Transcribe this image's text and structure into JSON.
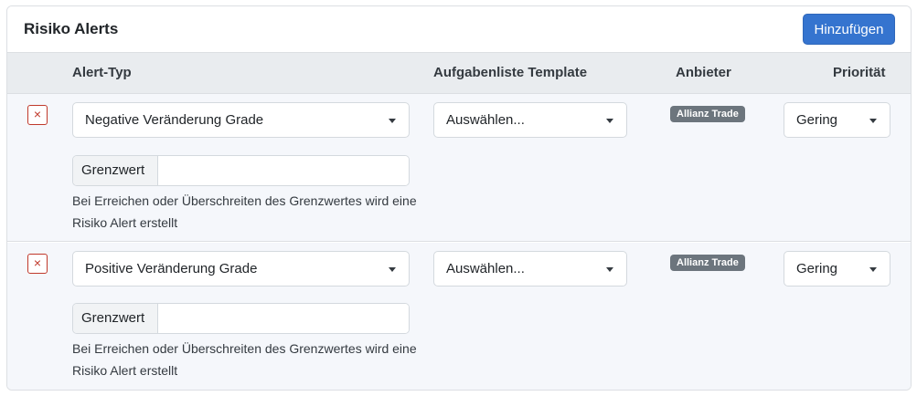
{
  "card": {
    "title": "Risiko Alerts",
    "add_label": "Hinzufügen"
  },
  "table": {
    "headers": {
      "alert_type": "Alert-Typ",
      "template": "Aufgabenliste Template",
      "provider": "Anbieter",
      "priority": "Priorität"
    },
    "rows": [
      {
        "delete_icon": "×",
        "alert_type": "Negative Veränderung Grade",
        "template": "Auswählen...",
        "provider": "Allianz Trade",
        "priority": "Gering",
        "threshold_label": "Grenzwert",
        "threshold_value": "",
        "help": "Bei Erreichen oder Überschreiten des Grenzwertes wird eine Risiko Alert erstellt"
      },
      {
        "delete_icon": "×",
        "alert_type": "Positive Veränderung Grade",
        "template": "Auswählen...",
        "provider": "Allianz Trade",
        "priority": "Gering",
        "threshold_label": "Grenzwert",
        "threshold_value": "",
        "help": "Bei Erreichen oder Überschreiten des Grenzwertes wird eine Risiko Alert erstellt"
      }
    ]
  },
  "colors": {
    "primary": "#3574cf",
    "danger": "#c0392b",
    "badge": "#6c757d",
    "header_bg": "#e9ecef",
    "row_bg": "#f5f7fb"
  }
}
